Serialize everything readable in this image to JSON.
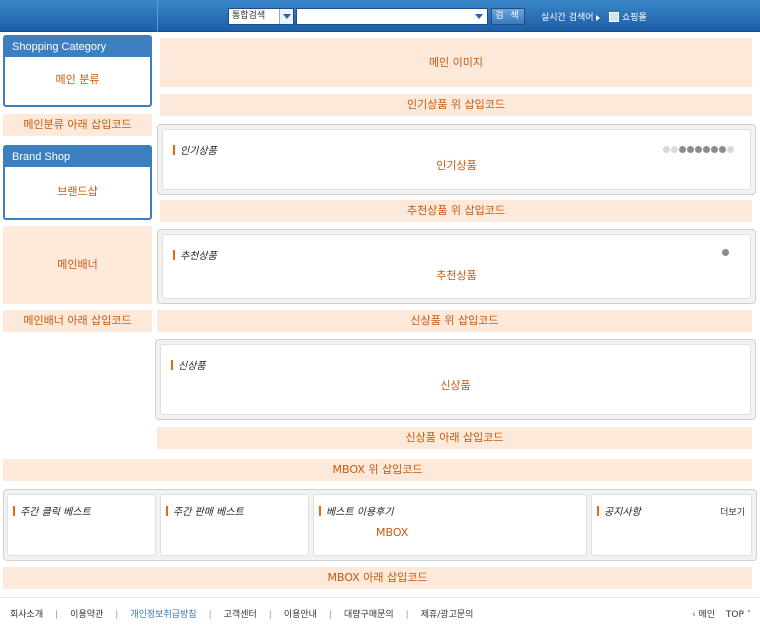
{
  "header": {
    "search_scope": "통합검색",
    "search_button": "검 색",
    "realtime_label": "실시간 검색어",
    "mall_label": "쇼핑몰"
  },
  "sidebar": {
    "category_title": "Shopping Category",
    "category_body": "메인 분류",
    "below_category": "메인분류 아래 삽입코드",
    "brand_title": "Brand Shop",
    "brand_body": "브랜드샵",
    "main_banner": "메인배너",
    "below_banner": "메인배너 아래 삽입코드"
  },
  "main": {
    "main_image": "메인 이미지",
    "above_popular": "인기상품 위 삽입코드",
    "popular_title": "인기상품",
    "popular_body": "인기상품",
    "above_recommended": "추천상품 위 삽입코드",
    "recommended_title": "추천상품",
    "recommended_body": "추천상품",
    "above_new": "신상품 위 삽입코드",
    "new_title": "신상품",
    "new_body": "신상품",
    "below_new": "신상품 아래 삽입코드",
    "above_mbox": "MBOX 위 삽입코드",
    "below_mbox": "MBOX 아래 삽입코드"
  },
  "mbox": {
    "weekly_click_title": "주간 클릭 베스트",
    "weekly_sales_title": "주간 판매 베스트",
    "best_review_title": "베스트 이용후기",
    "best_review_body": "MBOX",
    "notice_title": "공지사항",
    "more_label": "더보기"
  },
  "popular_dots": {
    "total": 9,
    "active_from": 2,
    "active_to": 7
  },
  "footer": {
    "links": [
      "회사소개",
      "이용약관",
      "개인정보취급방침",
      "고객센터",
      "이용안내",
      "대량구매문의",
      "제휴/광고문의"
    ],
    "main_link": "메인",
    "top_link": "TOP"
  },
  "colors": {
    "accent_blue": "#3b7fc0",
    "placeholder_text": "#c55a11",
    "placeholder_bg": "#fde9d9",
    "privacy_link": "#2e75b6"
  }
}
